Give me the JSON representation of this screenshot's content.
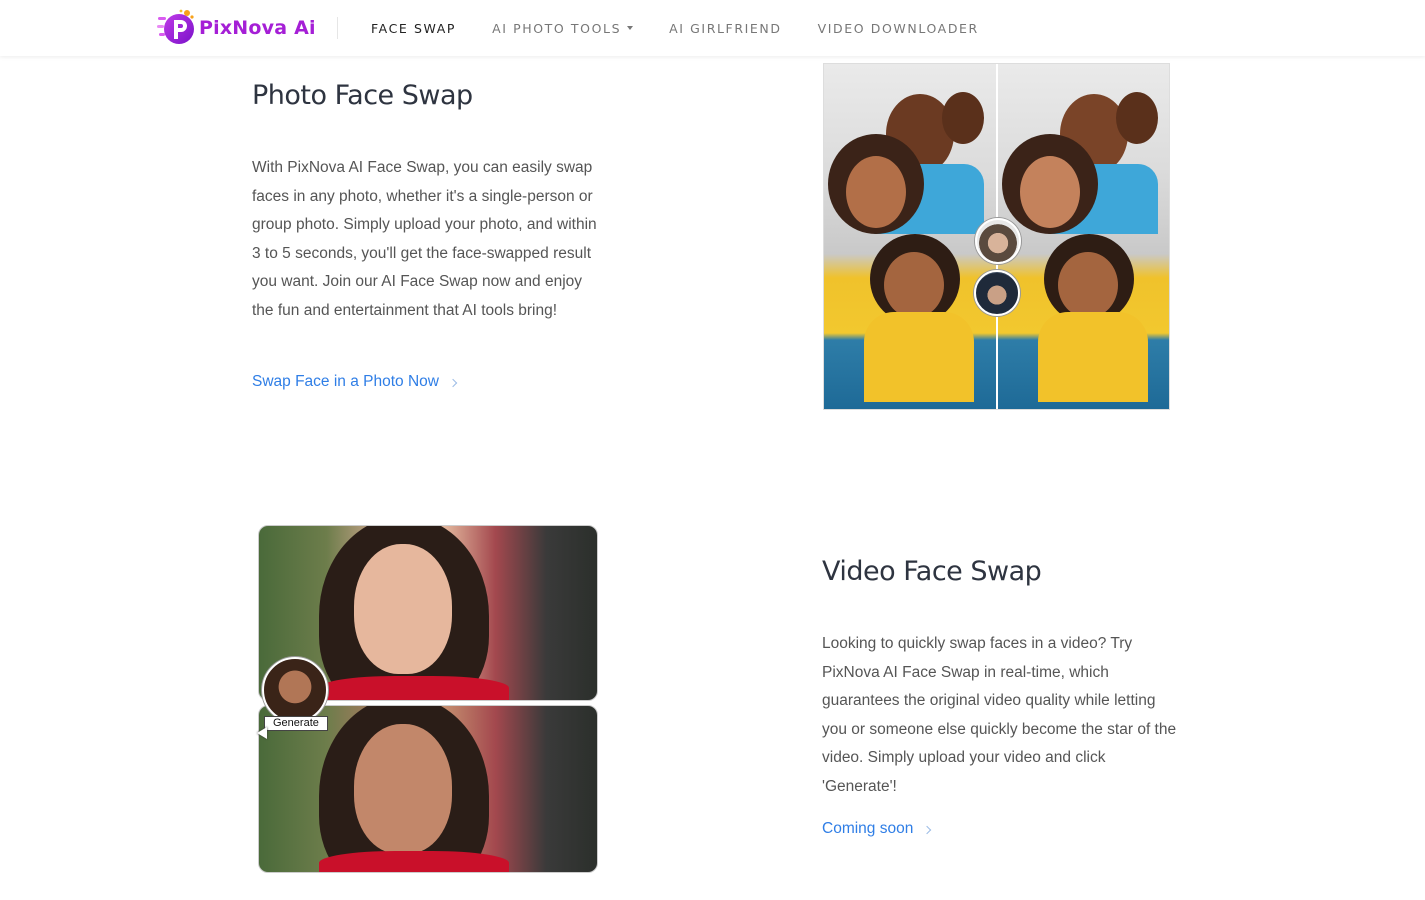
{
  "header": {
    "logo_text": "PixNova Ai",
    "nav": [
      {
        "label": "FACE SWAP",
        "active": true
      },
      {
        "label": "AI PHOTO TOOLS",
        "has_dropdown": true
      },
      {
        "label": "AI GIRLFRIEND"
      },
      {
        "label": "VIDEO DOWNLOADER"
      }
    ]
  },
  "photo_section": {
    "title": "Photo Face Swap",
    "body": "With PixNova AI Face Swap, you can easily swap faces in any photo, whether it's a single-person or group photo. Simply upload your photo, and within 3 to 5 seconds, you'll get the face-swapped result you want. Join our AI Face Swap now and enjoy the fun and entertainment that AI tools bring!",
    "link": "Swap Face in a Photo Now"
  },
  "video_section": {
    "title": "Video Face Swap",
    "body": "Looking to quickly swap faces in a video? Try PixNova AI Face Swap in real-time, which guarantees the original video quality while letting you or someone else quickly become the star of the video. Simply upload your video and click 'Generate'!",
    "link": "Coming soon",
    "generate_label": "Generate"
  },
  "colors": {
    "brand": "#a51fd6",
    "link": "#2f7ee6",
    "title": "#2e3440",
    "body": "#555555"
  },
  "icons": {
    "logo": "pixnova-logo-icon",
    "dropdown": "caret-down-icon",
    "link_arrow": "chevron-right-icon"
  }
}
